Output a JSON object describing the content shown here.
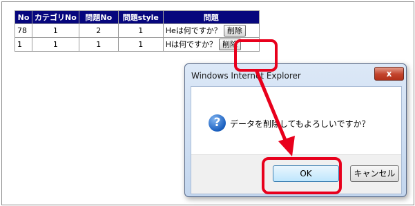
{
  "table": {
    "headers": [
      "No",
      "カテゴリNo",
      "問題No",
      "問題style",
      "問題"
    ],
    "rows": [
      {
        "no": "78",
        "category": "1",
        "mondai_no": "2",
        "style": "1",
        "question": "Heは何ですか？",
        "delete_label": "削除"
      },
      {
        "no": "1",
        "category": "1",
        "mondai_no": "1",
        "style": "1",
        "question": "Hは何ですか？",
        "delete_label": "削除"
      }
    ],
    "header_color": "#06067d"
  },
  "dialog": {
    "title": "Windows Internet Explorer",
    "close_label": "x",
    "icon": "question-icon",
    "message": "データを削除してもよろしいですか？",
    "ok_label": "OK",
    "cancel_label": "キャンセル"
  },
  "annotation_color": "#e8001c"
}
